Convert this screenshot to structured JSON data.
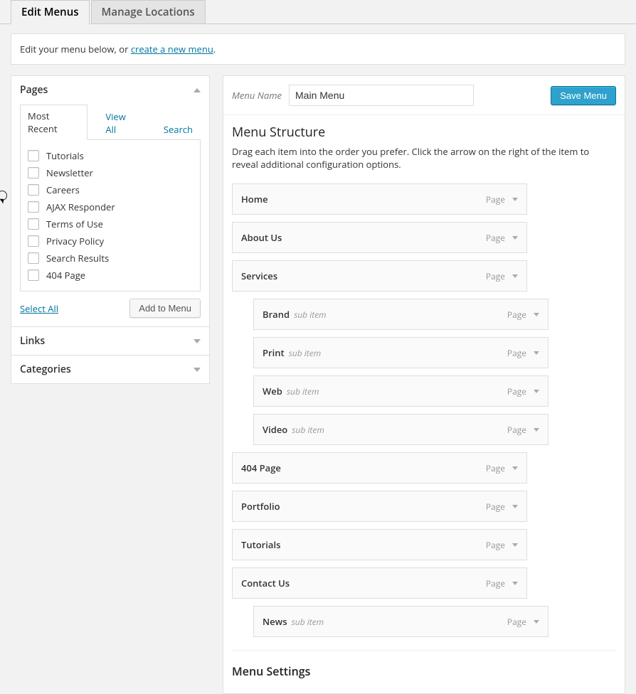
{
  "tabs": {
    "edit": "Edit Menus",
    "manage": "Manage Locations"
  },
  "infoBar": {
    "prefix": "Edit your menu below, or ",
    "link": "create a new menu",
    "suffix": "."
  },
  "pagesBox": {
    "title": "Pages",
    "subtabs": {
      "recent": "Most Recent",
      "viewAll": "View All",
      "search": "Search"
    },
    "items": [
      "Tutorials",
      "Newsletter",
      "Careers",
      "AJAX Responder",
      "Terms of Use",
      "Privacy Policy",
      "Search Results",
      "404 Page"
    ],
    "selectAll": "Select All",
    "addToMenu": "Add to Menu"
  },
  "linksBox": {
    "title": "Links"
  },
  "categoriesBox": {
    "title": "Categories"
  },
  "menu": {
    "nameLabel": "Menu Name",
    "nameValue": "Main Menu",
    "save": "Save Menu",
    "structureTitle": "Menu Structure",
    "structureDesc": "Drag each item into the order you prefer. Click the arrow on the right of the item to reveal additional configuration options.",
    "typeLabel": "Page",
    "subItemLabel": "sub item",
    "items": [
      {
        "label": "Home",
        "sub": false
      },
      {
        "label": "About Us",
        "sub": false
      },
      {
        "label": "Services",
        "sub": false
      },
      {
        "label": "Brand",
        "sub": true
      },
      {
        "label": "Print",
        "sub": true
      },
      {
        "label": "Web",
        "sub": true
      },
      {
        "label": "Video",
        "sub": true
      },
      {
        "label": "404 Page",
        "sub": false
      },
      {
        "label": "Portfolio",
        "sub": false
      },
      {
        "label": "Tutorials",
        "sub": false
      },
      {
        "label": "Contact Us",
        "sub": false
      },
      {
        "label": "News",
        "sub": true
      }
    ],
    "settingsTitle": "Menu Settings"
  }
}
